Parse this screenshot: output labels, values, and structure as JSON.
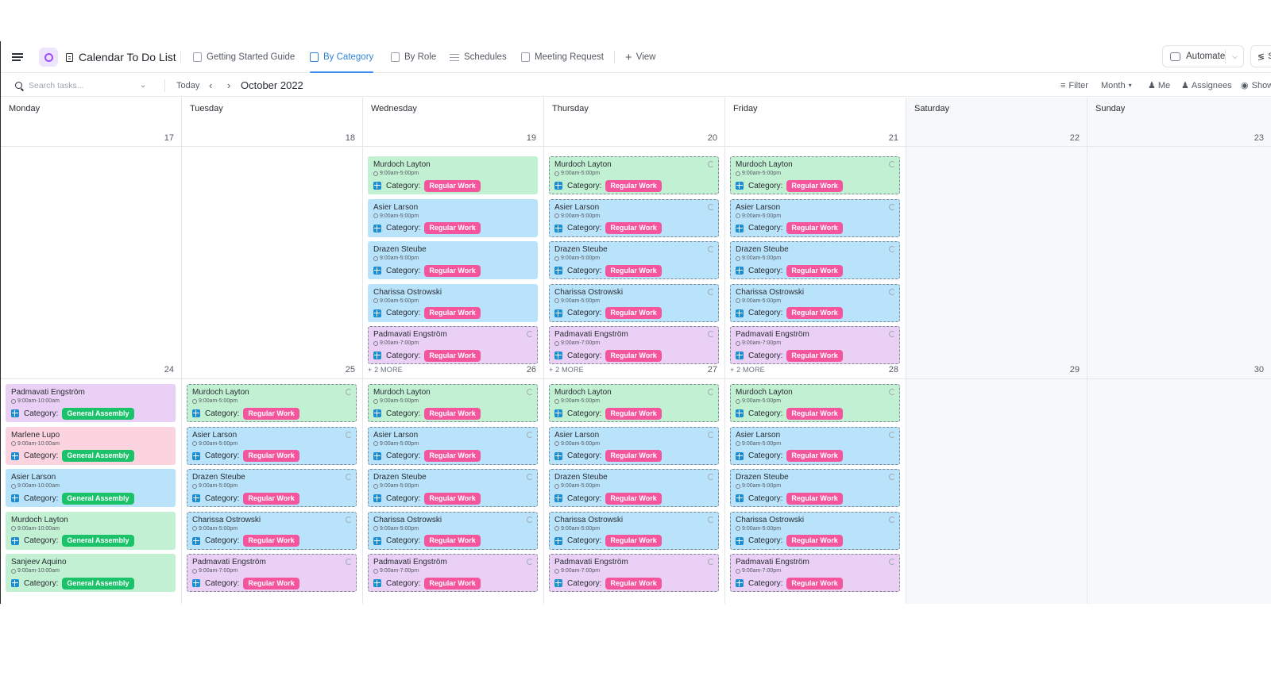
{
  "header": {
    "list_title": "Calendar To Do List",
    "tabs": [
      {
        "label": "Getting Started Guide",
        "icon": "doc-icon"
      },
      {
        "label": "By Category",
        "icon": "calendar-icon",
        "active": true
      },
      {
        "label": "By Role",
        "icon": "calendar-icon"
      },
      {
        "label": "Schedules",
        "icon": "list-icon"
      },
      {
        "label": "Meeting Request",
        "icon": "form-icon"
      }
    ],
    "add_view": "View",
    "automate": "Automate",
    "share": "S"
  },
  "toolbar": {
    "search_placeholder": "Search tasks...",
    "today": "Today",
    "month_label": "October 2022",
    "filter": "Filter",
    "month": "Month",
    "me": "Me",
    "assignees": "Assignees",
    "show": "Show"
  },
  "calendar": {
    "day_names": [
      "Monday",
      "Tuesday",
      "Wednesday",
      "Thursday",
      "Friday",
      "Saturday",
      "Sunday"
    ],
    "weeks": [
      {
        "dates": [
          "17",
          "18",
          "19",
          "20",
          "21",
          "22",
          "23"
        ],
        "more": [
          "",
          "",
          "",
          "",
          "",
          "",
          ""
        ],
        "days": [
          [],
          [],
          [
            {
              "name": "Murdoch Layton",
              "time": "9:00am-5:00pm",
              "category_label": "Category:",
              "tag": "Regular Work",
              "color": "green",
              "style": "solid"
            },
            {
              "name": "Asier Larson",
              "time": "9:00am-5:00pm",
              "category_label": "Category:",
              "tag": "Regular Work",
              "color": "blue",
              "style": "solid"
            },
            {
              "name": "Drazen Steube",
              "time": "9:00am-5:00pm",
              "category_label": "Category:",
              "tag": "Regular Work",
              "color": "blue",
              "style": "solid"
            },
            {
              "name": "Charissa Ostrowski",
              "time": "9:00am-5:00pm",
              "category_label": "Category:",
              "tag": "Regular Work",
              "color": "blue",
              "style": "solid"
            },
            {
              "name": "Padmavati Engström",
              "time": "9:00am-7:00pm",
              "category_label": "Category:",
              "tag": "Regular Work",
              "color": "purple",
              "style": "dashed"
            }
          ],
          [
            {
              "name": "Murdoch Layton",
              "time": "9:00am-5:00pm",
              "category_label": "Category:",
              "tag": "Regular Work",
              "color": "green",
              "style": "dashed"
            },
            {
              "name": "Asier Larson",
              "time": "9:00am-5:00pm",
              "category_label": "Category:",
              "tag": "Regular Work",
              "color": "blue",
              "style": "dashed"
            },
            {
              "name": "Drazen Steube",
              "time": "9:00am-5:00pm",
              "category_label": "Category:",
              "tag": "Regular Work",
              "color": "blue",
              "style": "dashed"
            },
            {
              "name": "Charissa Ostrowski",
              "time": "9:00am-5:00pm",
              "category_label": "Category:",
              "tag": "Regular Work",
              "color": "blue",
              "style": "dashed"
            },
            {
              "name": "Padmavati Engström",
              "time": "9:00am-7:00pm",
              "category_label": "Category:",
              "tag": "Regular Work",
              "color": "purple",
              "style": "dashed"
            }
          ],
          [
            {
              "name": "Murdoch Layton",
              "time": "9:00am-5:00pm",
              "category_label": "Category:",
              "tag": "Regular Work",
              "color": "green",
              "style": "dashed"
            },
            {
              "name": "Asier Larson",
              "time": "9:00am-5:00pm",
              "category_label": "Category:",
              "tag": "Regular Work",
              "color": "blue",
              "style": "dashed"
            },
            {
              "name": "Drazen Steube",
              "time": "9:00am-5:00pm",
              "category_label": "Category:",
              "tag": "Regular Work",
              "color": "blue",
              "style": "dashed"
            },
            {
              "name": "Charissa Ostrowski",
              "time": "9:00am-5:00pm",
              "category_label": "Category:",
              "tag": "Regular Work",
              "color": "blue",
              "style": "dashed"
            },
            {
              "name": "Padmavati Engström",
              "time": "9:00am-7:00pm",
              "category_label": "Category:",
              "tag": "Regular Work",
              "color": "purple",
              "style": "dashed"
            }
          ],
          [],
          []
        ]
      },
      {
        "dates": [
          "24",
          "25",
          "26",
          "27",
          "28",
          "29",
          "30"
        ],
        "more": [
          "",
          "",
          "+ 2 MORE",
          "+ 2 MORE",
          "+ 2 MORE",
          "",
          ""
        ],
        "days": [
          [
            {
              "name": "Padmavati Engström",
              "time": "9:00am-10:00am",
              "category_label": "Category:",
              "tag": "General Assembly",
              "color": "purple",
              "style": "solid"
            },
            {
              "name": "Marlene Lupo",
              "time": "9:00am-10:00am",
              "category_label": "Category:",
              "tag": "General Assembly",
              "color": "pink",
              "style": "solid"
            },
            {
              "name": "Asier Larson",
              "time": "9:00am-10:00am",
              "category_label": "Category:",
              "tag": "General Assembly",
              "color": "blue",
              "style": "solid"
            },
            {
              "name": "Murdoch Layton",
              "time": "9:00am-10:00am",
              "category_label": "Category:",
              "tag": "General Assembly",
              "color": "green",
              "style": "solid"
            },
            {
              "name": "Sanjeev Aquino",
              "time": "9:00am-10:00am",
              "category_label": "Category:",
              "tag": "General Assembly",
              "color": "green",
              "style": "solid"
            }
          ],
          [
            {
              "name": "Murdoch Layton",
              "time": "9:00am-5:00pm",
              "category_label": "Category:",
              "tag": "Regular Work",
              "color": "green",
              "style": "dashed"
            },
            {
              "name": "Asier Larson",
              "time": "9:00am-5:00pm",
              "category_label": "Category:",
              "tag": "Regular Work",
              "color": "blue",
              "style": "dashed"
            },
            {
              "name": "Drazen Steube",
              "time": "9:00am-5:00pm",
              "category_label": "Category:",
              "tag": "Regular Work",
              "color": "blue",
              "style": "dashed"
            },
            {
              "name": "Charissa Ostrowski",
              "time": "9:00am-5:00pm",
              "category_label": "Category:",
              "tag": "Regular Work",
              "color": "blue",
              "style": "dashed"
            },
            {
              "name": "Padmavati Engström",
              "time": "9:00am-7:00pm",
              "category_label": "Category:",
              "tag": "Regular Work",
              "color": "purple",
              "style": "dashed"
            }
          ],
          [
            {
              "name": "Murdoch Layton",
              "time": "9:00am-5:00pm",
              "category_label": "Category:",
              "tag": "Regular Work",
              "color": "green",
              "style": "dashed"
            },
            {
              "name": "Asier Larson",
              "time": "9:00am-5:00pm",
              "category_label": "Category:",
              "tag": "Regular Work",
              "color": "blue",
              "style": "dashed"
            },
            {
              "name": "Drazen Steube",
              "time": "9:00am-5:00pm",
              "category_label": "Category:",
              "tag": "Regular Work",
              "color": "blue",
              "style": "dashed"
            },
            {
              "name": "Charissa Ostrowski",
              "time": "9:00am-5:00pm",
              "category_label": "Category:",
              "tag": "Regular Work",
              "color": "blue",
              "style": "dashed"
            },
            {
              "name": "Padmavati Engström",
              "time": "9:00am-7:00pm",
              "category_label": "Category:",
              "tag": "Regular Work",
              "color": "purple",
              "style": "dashed"
            }
          ],
          [
            {
              "name": "Murdoch Layton",
              "time": "9:00am-5:00pm",
              "category_label": "Category:",
              "tag": "Regular Work",
              "color": "green",
              "style": "dashed"
            },
            {
              "name": "Asier Larson",
              "time": "9:00am-5:00pm",
              "category_label": "Category:",
              "tag": "Regular Work",
              "color": "blue",
              "style": "dashed"
            },
            {
              "name": "Drazen Steube",
              "time": "9:00am-5:00pm",
              "category_label": "Category:",
              "tag": "Regular Work",
              "color": "blue",
              "style": "dashed"
            },
            {
              "name": "Charissa Ostrowski",
              "time": "9:00am-5:00pm",
              "category_label": "Category:",
              "tag": "Regular Work",
              "color": "blue",
              "style": "dashed"
            },
            {
              "name": "Padmavati Engström",
              "time": "9:00am-7:00pm",
              "category_label": "Category:",
              "tag": "Regular Work",
              "color": "purple",
              "style": "dashed"
            }
          ],
          [
            {
              "name": "Murdoch Layton",
              "time": "9:00am-5:00pm",
              "category_label": "Category:",
              "tag": "Regular Work",
              "color": "green",
              "style": "dashed"
            },
            {
              "name": "Asier Larson",
              "time": "9:00am-5:00pm",
              "category_label": "Category:",
              "tag": "Regular Work",
              "color": "blue",
              "style": "dashed"
            },
            {
              "name": "Drazen Steube",
              "time": "9:00am-5:00pm",
              "category_label": "Category:",
              "tag": "Regular Work",
              "color": "blue",
              "style": "dashed"
            },
            {
              "name": "Charissa Ostrowski",
              "time": "9:00am-5:00pm",
              "category_label": "Category:",
              "tag": "Regular Work",
              "color": "blue",
              "style": "dashed"
            },
            {
              "name": "Padmavati Engström",
              "time": "9:00am-7:00pm",
              "category_label": "Category:",
              "tag": "Regular Work",
              "color": "purple",
              "style": "dashed"
            }
          ],
          [],
          []
        ]
      }
    ]
  },
  "colors": {
    "accent": "#2f84d6",
    "regular_work_tag": "#f5559c",
    "general_assembly_tag": "#1ac36a",
    "green_card": "#c2f0d2",
    "blue_card": "#b9e3fa",
    "purple_card": "#ebd0f5",
    "pink_card": "#fbd4e0"
  }
}
